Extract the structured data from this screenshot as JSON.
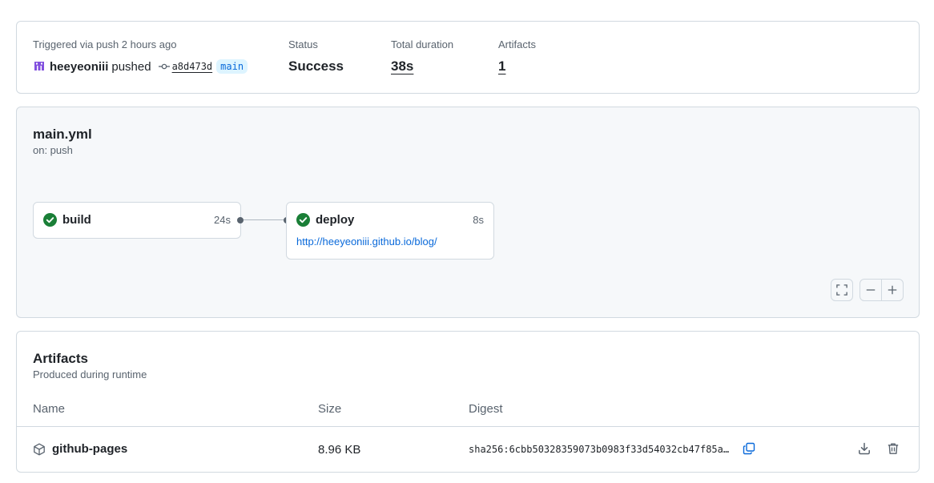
{
  "summary": {
    "trigger_label": "Triggered via push 2 hours ago",
    "actor": "heeyeoniii",
    "action": "pushed",
    "commit_sha": "a8d473d",
    "branch": "main",
    "status_label": "Status",
    "status_value": "Success",
    "duration_label": "Total duration",
    "duration_value": "38s",
    "artifacts_label": "Artifacts",
    "artifacts_value": "1"
  },
  "workflow": {
    "file_name": "main.yml",
    "trigger": "on: push",
    "jobs": [
      {
        "name": "build",
        "duration": "24s",
        "status": "success"
      },
      {
        "name": "deploy",
        "duration": "8s",
        "status": "success",
        "link": "http://heeyeoniii.github.io/blog/"
      }
    ]
  },
  "artifacts": {
    "title": "Artifacts",
    "subtitle": "Produced during runtime",
    "columns": [
      "Name",
      "Size",
      "Digest"
    ],
    "rows": [
      {
        "name": "github-pages",
        "size": "8.96 KB",
        "digest": "sha256:6cbb50328359073b0983f33d54032cb47f85a…"
      }
    ]
  },
  "colors": {
    "success": "#1a7f37",
    "link": "#0969da",
    "avatar": "#8250df"
  },
  "icons": {
    "check": "check-circle-icon",
    "commit": "git-commit-icon",
    "package": "package-icon",
    "copy": "copy-icon",
    "download": "download-icon",
    "trash": "trash-icon",
    "fullscreen": "fullscreen-icon"
  }
}
